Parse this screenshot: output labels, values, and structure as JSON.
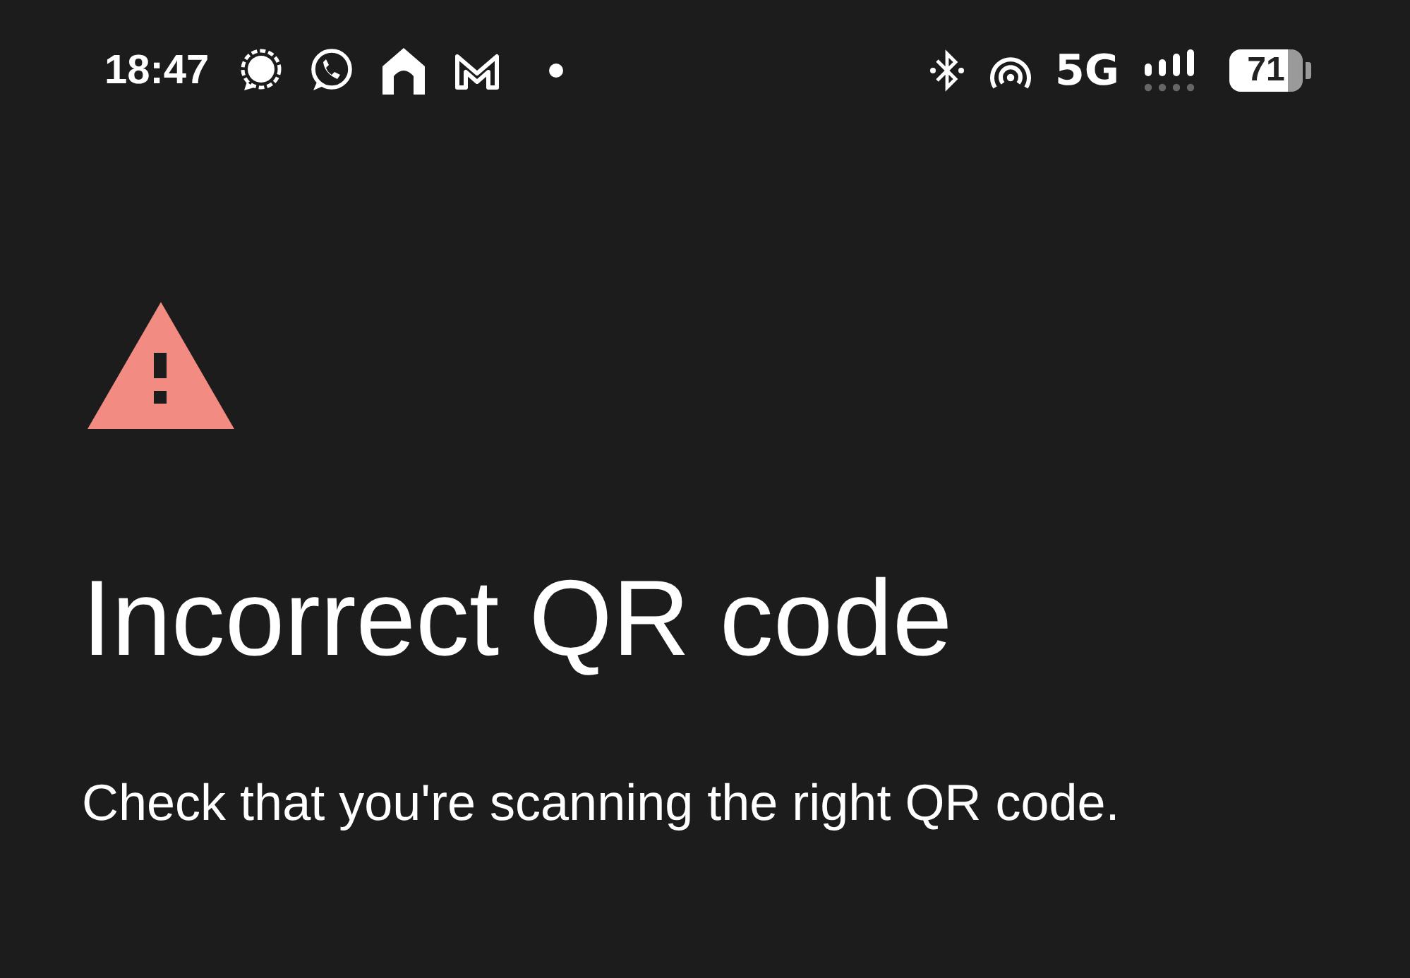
{
  "status_bar": {
    "time": "18:47",
    "network": "5G",
    "battery": "71"
  },
  "title": "Incorrect QR code",
  "message": "Check that you're scanning the right QR code."
}
